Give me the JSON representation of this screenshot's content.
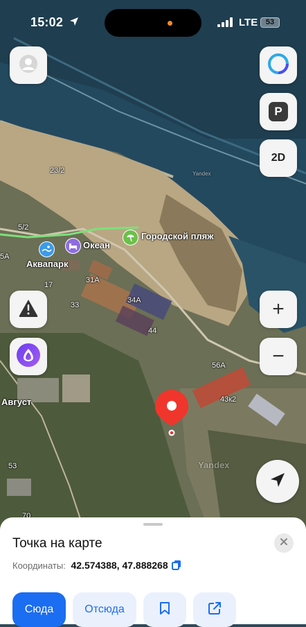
{
  "status_bar": {
    "time": "15:02",
    "network": "LTE",
    "battery": "53"
  },
  "map": {
    "labels": {
      "city_beach": "Городской пляж",
      "ocean": "Океан",
      "aquapark": "Аквапарк",
      "avgust": "Август",
      "h23_2": "23/2",
      "h5_2": "5/2",
      "h5a": "5А",
      "h17": "17",
      "h31a": "31А",
      "h33": "33",
      "h34a": "34А",
      "h44": "44",
      "h56a": "56А",
      "h43k2": "43к2",
      "h53": "53",
      "h70": "70",
      "watermark": "Yandex"
    },
    "controls": {
      "parking_label": "P",
      "view_mode": "2D",
      "zoom_in": "+",
      "zoom_out": "−"
    },
    "icons": [
      "user-icon",
      "alice-icon",
      "warning-icon",
      "alice-logo-icon",
      "navigation-arrow-icon",
      "location-pin-icon"
    ]
  },
  "sheet": {
    "title": "Точка на карте",
    "coords_label": "Координаты:",
    "coords_value": "42.574388, 47.888268",
    "buttons": {
      "to_here": "Сюда",
      "from_here": "Отсюда"
    }
  },
  "colors": {
    "accent": "#1b6df2",
    "pin": "#f0352c"
  }
}
